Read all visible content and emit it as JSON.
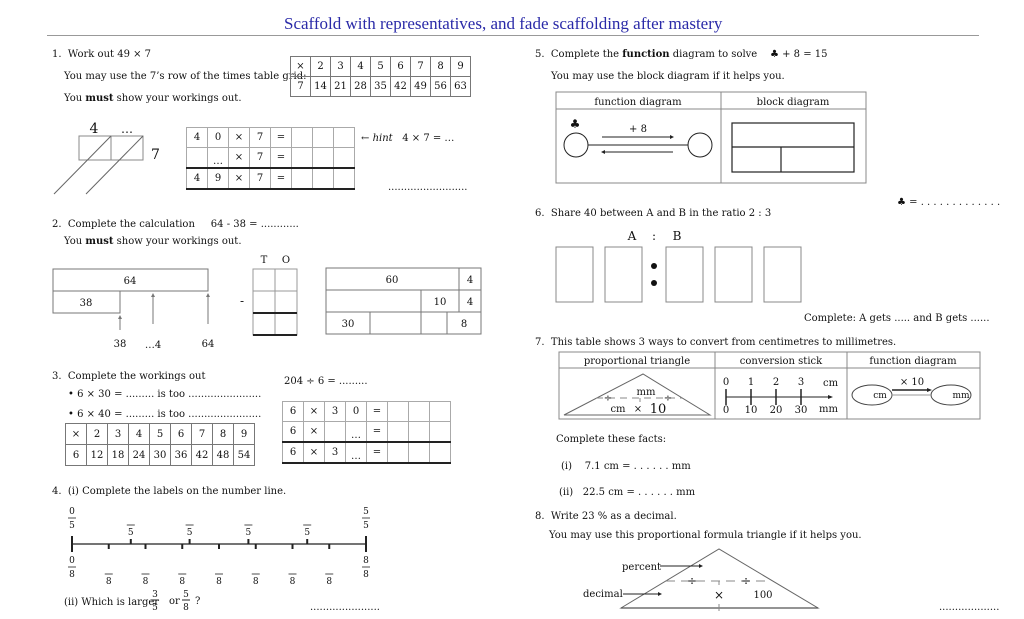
{
  "title": "Scaffold with representatives, and fade scaffolding after mastery",
  "q1": {
    "number": "1.",
    "prompt": "Work out 49 × 7",
    "hint_grid_text": "You may use the 7’s row of the times table grid:",
    "must_pre": "You ",
    "must_bold": "must",
    "must_post": " show your workings out.",
    "times_row_header": [
      "×",
      "2",
      "3",
      "4",
      "5",
      "6",
      "7",
      "8",
      "9"
    ],
    "times_row_values": [
      "7",
      "14",
      "21",
      "28",
      "35",
      "42",
      "49",
      "56",
      "63"
    ],
    "grid_label_top_left": "4",
    "grid_label_top_right": "…",
    "grid_label_right": "7",
    "calc_rows": [
      [
        "4",
        "0",
        "×",
        "7",
        "=",
        "",
        "",
        ""
      ],
      [
        "",
        "…",
        "×",
        "7",
        "=",
        "",
        "",
        ""
      ],
      [
        "4",
        "9",
        "×",
        "7",
        "=",
        "",
        "",
        ""
      ]
    ],
    "hint_arrow": "←",
    "hint_word": "hint",
    "hint_expr": "4 × 7 = …",
    "answer_line": "........................."
  },
  "q2": {
    "number": "2.",
    "prompt": "Complete the calculation",
    "expr": "64 - 38 = ............",
    "must_pre": "You ",
    "must_bold": "must",
    "must_post": " show your workings out.",
    "bar_top": "64",
    "bar_bottom": "38",
    "numline_labels": [
      "38",
      "…4",
      "64"
    ],
    "column_headers": [
      "T",
      "O"
    ],
    "minus_sign": "-",
    "partition": {
      "row1": [
        "60",
        "4"
      ],
      "row2": [
        "10",
        "4"
      ],
      "row3": [
        "30",
        "8"
      ]
    }
  },
  "q3": {
    "number": "3.",
    "prompt": "Complete the workings out",
    "bullet1": "• 6 × 30 = ......... is too .......................",
    "bullet2": "• 6 × 40 = ......... is too .......................",
    "times_row_header": [
      "×",
      "2",
      "3",
      "4",
      "5",
      "6",
      "7",
      "8",
      "9"
    ],
    "times_row_values": [
      "6",
      "12",
      "18",
      "24",
      "30",
      "36",
      "42",
      "48",
      "54"
    ],
    "division_expr": "204 ÷ 6 = .........",
    "calc_rows": [
      [
        "6",
        "×",
        "3",
        "0",
        "=",
        "",
        "",
        ""
      ],
      [
        "6",
        "×",
        "",
        "…",
        "=",
        "",
        "",
        ""
      ],
      [
        "6",
        "×",
        "3",
        "…",
        "=",
        "",
        "",
        ""
      ]
    ]
  },
  "q4": {
    "number": "4.",
    "prompt": "(i) Complete the labels on the number line.",
    "fifths": [
      {
        "num": "0",
        "den": "5"
      },
      {
        "num": "",
        "den": "5"
      },
      {
        "num": "",
        "den": "5"
      },
      {
        "num": "",
        "den": "5"
      },
      {
        "num": "",
        "den": "5"
      },
      {
        "num": "5",
        "den": "5"
      }
    ],
    "eighths": [
      {
        "num": "0",
        "den": "8"
      },
      {
        "num": "",
        "den": "8"
      },
      {
        "num": "",
        "den": "8"
      },
      {
        "num": "",
        "den": "8"
      },
      {
        "num": "",
        "den": "8"
      },
      {
        "num": "",
        "den": "8"
      },
      {
        "num": "",
        "den": "8"
      },
      {
        "num": "",
        "den": "8"
      },
      {
        "num": "8",
        "den": "8"
      }
    ],
    "part2_pre": "(ii) Which is larger",
    "frac_a": {
      "num": "3",
      "den": "5"
    },
    "or": "or",
    "frac_b": {
      "num": "5",
      "den": "8"
    },
    "qmark": "?",
    "answer_line": "......................"
  },
  "q5": {
    "number": "5.",
    "prompt_pre": "Complete the ",
    "prompt_bold": "function",
    "prompt_post": " diagram to solve",
    "equation": "♣ + 8 = 15",
    "sub": "You may use the block diagram if it helps you.",
    "col1": "function diagram",
    "col2": "block diagram",
    "club": "♣",
    "op": "+ 8",
    "answer": "♣ = . . . . . . . . . . . . ."
  },
  "q6": {
    "number": "6.",
    "prompt": "Share 40 between A and B in the ratio 2 : 3",
    "label_a": "A",
    "colon": ":",
    "label_b": "B",
    "complete": "Complete: A gets ..... and B gets ......"
  },
  "q7": {
    "number": "7.",
    "prompt": "This table shows 3 ways to convert from centimetres to millimetres.",
    "headers": [
      "proportional triangle",
      "conversion stick",
      "function diagram"
    ],
    "triangle": {
      "top": "mm",
      "div": "÷",
      "bottom_left": "cm",
      "times": "×",
      "factor": "10"
    },
    "stick": {
      "cm_values": [
        "0",
        "1",
        "2",
        "3"
      ],
      "cm_unit": "cm",
      "mm_values": [
        "0",
        "10",
        "20",
        "30"
      ],
      "mm_unit": "mm"
    },
    "func": {
      "in": "cm",
      "op": "× 10",
      "out": "mm"
    },
    "facts_title": "Complete these facts:",
    "facts": [
      {
        "label": "(i)",
        "expr": "7.1  cm =  . . . . . . mm"
      },
      {
        "label": "(ii)",
        "expr": "22.5  cm =  . . . . . . mm"
      }
    ]
  },
  "q8": {
    "number": "8.",
    "prompt": "Write 23 % as a decimal.",
    "sub": "You may use this proportional formula triangle if it helps you.",
    "label_percent": "percent",
    "label_decimal": "decimal",
    "div": "÷",
    "times": "×",
    "factor": "100",
    "answer_line": "..................."
  }
}
